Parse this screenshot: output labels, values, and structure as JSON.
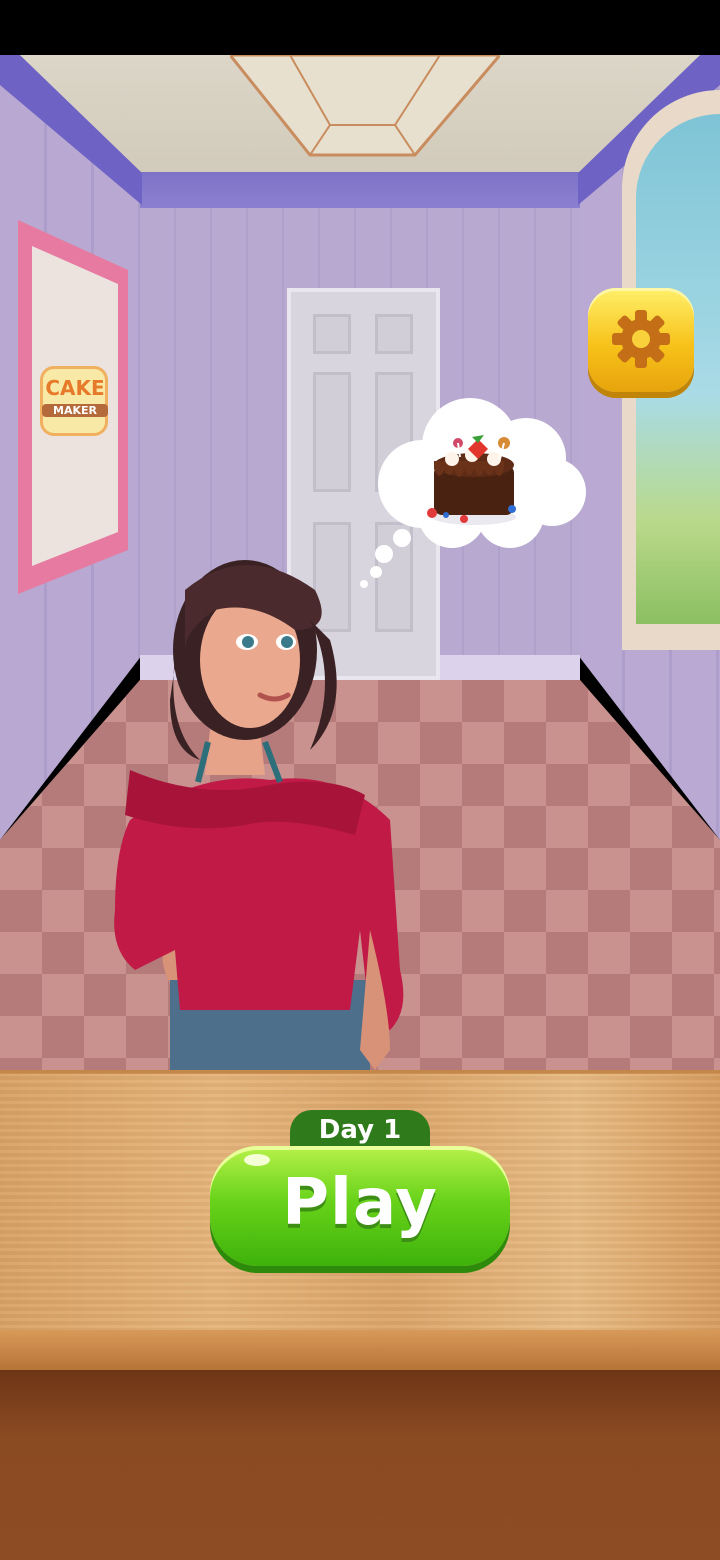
{
  "poster": {
    "logo_line1": "CAKE",
    "logo_line2": "MAKER"
  },
  "day_tab": {
    "label": "Day 1"
  },
  "play_button": {
    "label": "Play"
  },
  "icons": {
    "settings": "gear-icon",
    "thought": "cake-icon"
  },
  "colors": {
    "play_green": "#4cc21a",
    "settings_yellow": "#f7c21a",
    "wall_purple": "#b7a9d0"
  }
}
